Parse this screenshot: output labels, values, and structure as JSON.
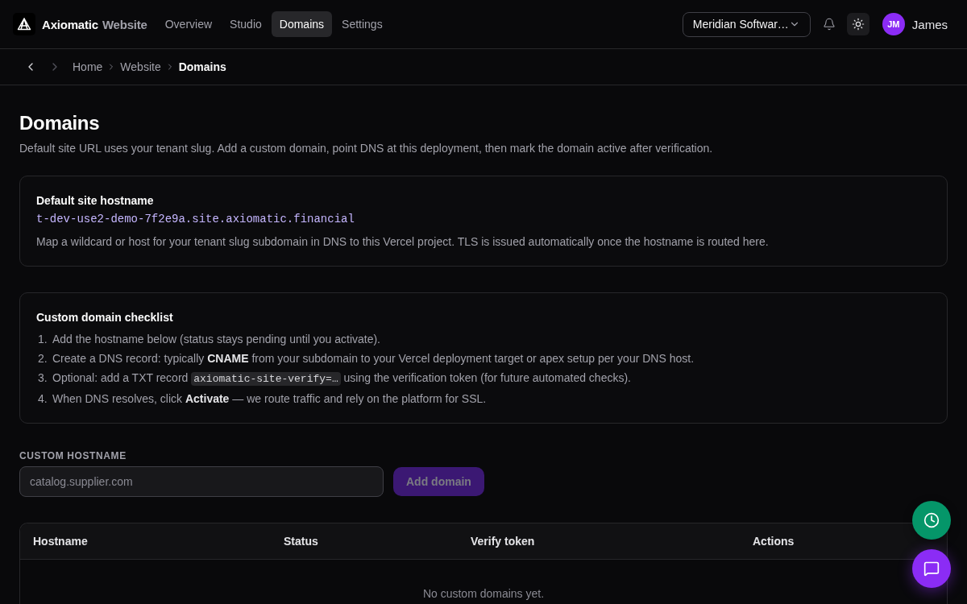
{
  "header": {
    "brand": {
      "name": "Axiomatic",
      "product": "Website"
    },
    "nav": [
      {
        "label": "Overview",
        "selected": false
      },
      {
        "label": "Studio",
        "selected": false
      },
      {
        "label": "Domains",
        "selected": true
      },
      {
        "label": "Settings",
        "selected": false
      }
    ],
    "org_selector": {
      "value": "Meridian Softwar…"
    },
    "user": {
      "initials": "JM",
      "name": "James"
    }
  },
  "breadcrumb": {
    "back": {
      "disabled": false
    },
    "forward": {
      "disabled": true
    },
    "items": [
      {
        "label": "Home",
        "current": false
      },
      {
        "label": "Website",
        "current": false
      },
      {
        "label": "Domains",
        "current": true
      }
    ]
  },
  "page": {
    "title": "Domains",
    "subtitle": "Default site URL uses your tenant slug. Add a custom domain, point DNS at this deployment, then mark the domain active after verification."
  },
  "default_hostname_card": {
    "title": "Default site hostname",
    "hostname": "t-dev-use2-demo-7f2e9a.site.axiomatic.financial",
    "description": "Map a wildcard or host for your tenant slug subdomain in DNS to this Vercel project. TLS is issued automatically once the hostname is routed here."
  },
  "checklist_card": {
    "title": "Custom domain checklist",
    "items": [
      {
        "number": "1.",
        "segments": [
          {
            "kind": "text",
            "text": "Add the hostname below (status stays pending until you activate)."
          }
        ]
      },
      {
        "number": "2.",
        "segments": [
          {
            "kind": "text",
            "text": "Create a DNS record: typically **CNAME** from your subdomain to your Vercel deployment target or apex setup per your DNS host."
          }
        ]
      },
      {
        "number": "3.",
        "segments": [
          {
            "kind": "text",
            "text": "Optional: add a TXT record "
          },
          {
            "kind": "code",
            "text": "axiomatic-site-verify=…"
          },
          {
            "kind": "text",
            "text": " using the verification token (for future automated checks)."
          }
        ]
      },
      {
        "number": "4.",
        "segments": [
          {
            "kind": "text",
            "text": "When DNS resolves, click **Activate** — we route traffic and rely on the platform for SSL."
          }
        ]
      }
    ]
  },
  "custom_hostname_form": {
    "label": "CUSTOM HOSTNAME",
    "placeholder": "catalog.supplier.com",
    "button": {
      "label": "Add domain",
      "disabled": true
    }
  },
  "domains_table": {
    "columns": [
      "Hostname",
      "Status",
      "Verify token",
      "Actions"
    ],
    "empty_message": "No custom domains yet."
  }
}
